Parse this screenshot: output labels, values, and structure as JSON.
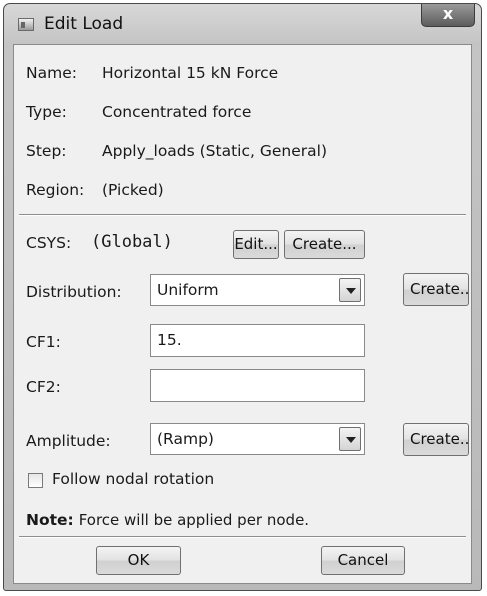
{
  "window": {
    "title": "Edit Load",
    "close_glyph": "x"
  },
  "info": {
    "name_label": "Name:",
    "name_value": "Horizontal 15 kN Force",
    "type_label": "Type:",
    "type_value": "Concentrated force",
    "step_label": "Step:",
    "step_value": "Apply_loads (Static, General)",
    "region_label": "Region:",
    "region_value": "(Picked)"
  },
  "csys": {
    "label": "CSYS:",
    "value": "(Global)",
    "edit_label": "Edit...",
    "create_label": "Create..."
  },
  "distribution": {
    "label": "Distribution:",
    "value": "Uniform",
    "create_label": "Create..."
  },
  "cf1": {
    "label": "CF1:",
    "value": "15."
  },
  "cf2": {
    "label": "CF2:",
    "value": ""
  },
  "amplitude": {
    "label": "Amplitude:",
    "value": "(Ramp)",
    "create_label": "Create..."
  },
  "follow_nodal_rotation": {
    "label": "Follow nodal rotation",
    "checked": false
  },
  "note": {
    "bold": "Note:",
    "text": "Force will be applied per node."
  },
  "footer": {
    "ok_label": "OK",
    "cancel_label": "Cancel"
  }
}
